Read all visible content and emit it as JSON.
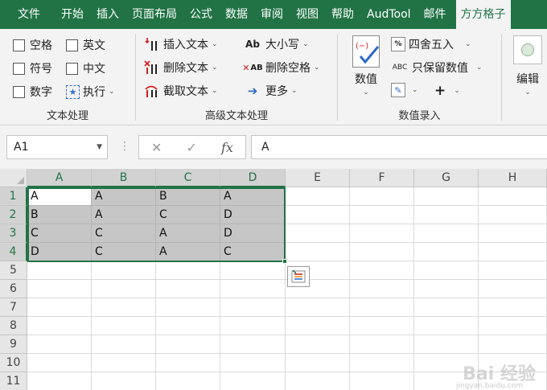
{
  "colors": {
    "brand": "#217346",
    "selection": "#c6c6c6",
    "ribbon_bg": "#f3f3f3"
  },
  "tabs": [
    "文件",
    "开始",
    "插入",
    "页面布局",
    "公式",
    "数据",
    "审阅",
    "视图",
    "帮助",
    "AudTool",
    "邮件",
    "方方格子"
  ],
  "ribbon": {
    "text_group": {
      "label": "文本处理",
      "checks": [
        {
          "label": "空格"
        },
        {
          "label": "英文"
        },
        {
          "label": "符号"
        },
        {
          "label": "中文"
        },
        {
          "label": "数字"
        }
      ],
      "execute_label": "执行"
    },
    "advanced_group": {
      "label": "高级文本处理",
      "insert_text": "插入文本",
      "delete_text": "删除文本",
      "extract_text": "截取文本",
      "case_label": "大小写",
      "delete_space": "删除空格",
      "more": "更多"
    },
    "number_group": {
      "label": "数值录入",
      "value_label": "数值",
      "round_label": "四舍五入",
      "keep_value": "只保留数值",
      "plus": "+"
    },
    "edit_label": "编辑"
  },
  "formula_bar": {
    "name_box": "A1",
    "fx": "fx",
    "value": "A"
  },
  "grid": {
    "columns": [
      "A",
      "B",
      "C",
      "D",
      "E",
      "F",
      "G",
      "H"
    ],
    "rows": [
      "1",
      "2",
      "3",
      "4",
      "5",
      "6",
      "7",
      "8",
      "9",
      "10",
      "11"
    ],
    "cells": [
      [
        "A",
        "A",
        "B",
        "A"
      ],
      [
        "B",
        "A",
        "C",
        "D"
      ],
      [
        "C",
        "C",
        "A",
        "D"
      ],
      [
        "D",
        "C",
        "A",
        "C"
      ]
    ]
  },
  "watermark": {
    "text": "Bai 经验",
    "sub": "jingyan.baidu.com"
  }
}
